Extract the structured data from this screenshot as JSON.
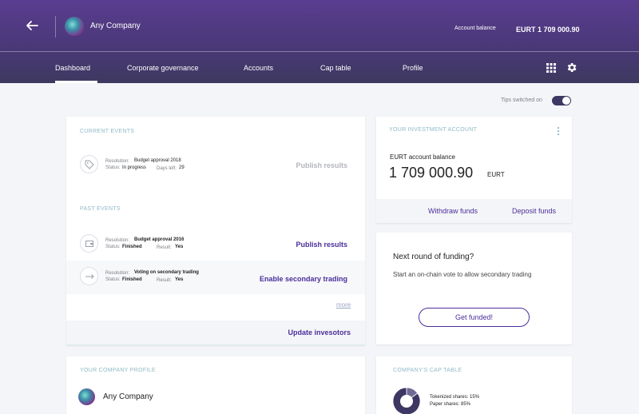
{
  "header": {
    "company_name": "Any Company",
    "account_balance_label": "Account balance",
    "account_balance_value": "EURT 1 709 000.90"
  },
  "nav": {
    "items": [
      {
        "label": "Dashboard",
        "active": true
      },
      {
        "label": "Corporate governance"
      },
      {
        "label": "Accounts"
      },
      {
        "label": "Cap table"
      },
      {
        "label": "Profile"
      }
    ]
  },
  "tips": {
    "label": "Tips switched on",
    "enabled": true
  },
  "events": {
    "current_title": "CURRENT EVENTS",
    "past_title": "PAST EVENTS",
    "resolution_key": "Resolution:",
    "status_key": "Status:",
    "days_left_key": "Days left:",
    "result_key": "Result:",
    "current": [
      {
        "resolution": "Budget approval 2018",
        "status": "In progress",
        "days_left": "29",
        "action": "Publish results"
      }
    ],
    "past": [
      {
        "resolution": "Budget approval 2016",
        "status": "Finished",
        "result": "Yes",
        "action": "Publish results"
      },
      {
        "resolution": "Voting on secondary trading",
        "status": "Finished",
        "result": "Yes",
        "action": "Enable secondary trading"
      }
    ],
    "more_label": "more",
    "footer_action": "Update invesotors"
  },
  "investment": {
    "title": "YOUR INVESTMENT ACCOUNT",
    "balance_label": "EURT account balance",
    "balance_amount": "1 709 000.90",
    "currency": "EURT",
    "withdraw_label": "Withdraw funds",
    "deposit_label": "Deposit funds"
  },
  "funding": {
    "title": "Next round of funding?",
    "text": "Start an on-chain vote to allow secondary trading",
    "button_label": "Get funded!"
  },
  "profile": {
    "title": "YOUR COMPANY PROFILE",
    "company_name": "Any Company"
  },
  "cap_table": {
    "title": "COMPANY'S CAP TABLE",
    "rows": [
      {
        "label": "Tokenized shares:",
        "value": "15%"
      },
      {
        "label": "Paper shares:",
        "value": "85%"
      }
    ]
  },
  "chart_data": {
    "type": "pie",
    "categories": [
      "Tokenized shares",
      "Paper shares"
    ],
    "values": [
      15,
      85
    ]
  },
  "colors": {
    "accent": "#4b2e9b",
    "header_top": "#5a3d90",
    "header_bottom": "#3e3960",
    "muted_title": "#8fbac7",
    "pie_dark": "#3d3763",
    "pie_light": "#6f6b95"
  }
}
